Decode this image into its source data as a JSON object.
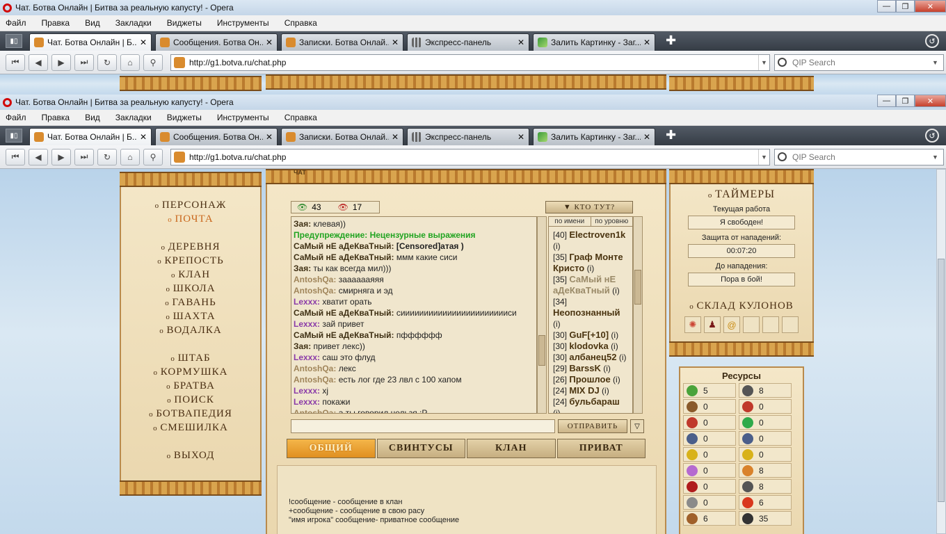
{
  "browser": {
    "title": "Чат. Ботва Онлайн | Битва за реальную капусту! - Opera",
    "menu": [
      "Файл",
      "Правка",
      "Вид",
      "Закладки",
      "Виджеты",
      "Инструменты",
      "Справка"
    ],
    "tabs": [
      {
        "label": "Чат. Ботва Онлайн | Б..."
      },
      {
        "label": "Сообщения. Ботва Он..."
      },
      {
        "label": "Записки. Ботва Онлай..."
      },
      {
        "label": "Экспресс-панель"
      },
      {
        "label": "Залить Картинку - Заг..."
      }
    ],
    "url": "http://g1.botva.ru/chat.php",
    "search_placeholder": "QIP Search"
  },
  "left_menu": [
    "ПЕРСОНАЖ",
    "ПОЧТА",
    "ДЕРЕВНЯ",
    "КРЕПОСТЬ",
    "КЛАН",
    "ШКОЛА",
    "ГАВАНЬ",
    "ШАХТА",
    "ВОДАЛКА",
    "ШТАБ",
    "КОРМУШКА",
    "БРАТВА",
    "ПОИСК",
    "БОТВАПЕДИЯ",
    "СМЕШИЛКА",
    "ВЫХОД"
  ],
  "chat": {
    "header_label": "ЧАТ",
    "online_count": "43",
    "watch_count": "17",
    "who_here": "КТО ТУТ?",
    "sort_by_name": "по имени",
    "sort_by_level": "по уровню",
    "send_label": "ОТПРАВИТЬ",
    "lines": [
      {
        "name": "Зая",
        "text": "клевая))",
        "cls": "n1"
      },
      {
        "name": "",
        "text": "Предупреждение: Нецензурные выражения",
        "cls": "warn"
      },
      {
        "name": "СаМый нЕ аДеКваТный",
        "text": "[Censored]атая )",
        "cls": "n1",
        "bold": true
      },
      {
        "name": "СаМый нЕ аДеКваТный",
        "text": "ммм какие сиси",
        "cls": "n1"
      },
      {
        "name": "Зая",
        "text": "ты как всегда мил)))",
        "cls": "n1"
      },
      {
        "name": "AntoshQa",
        "text": "зааааааяяя",
        "cls": "n2"
      },
      {
        "name": "AntoshQa",
        "text": "смирняга и эд",
        "cls": "n2"
      },
      {
        "name": "Lexxx",
        "text": "хватит орать",
        "cls": "n3"
      },
      {
        "name": "СаМый нЕ аДеКваТный",
        "text": "сиииииииииииииииииииииииси",
        "cls": "n1"
      },
      {
        "name": "Lexxx",
        "text": "зай привет",
        "cls": "n3"
      },
      {
        "name": "СаМый нЕ аДеКваТный",
        "text": "пфффффф",
        "cls": "n1"
      },
      {
        "name": "Зая",
        "text": "привет лекс))",
        "cls": "n1"
      },
      {
        "name": "Lexxx",
        "text": "саш это флуд",
        "cls": "n3"
      },
      {
        "name": "AntoshQa",
        "text": "лекс",
        "cls": "n2"
      },
      {
        "name": "AntoshQa",
        "text": "есть лог где 23 лвл с 100 хапом",
        "cls": "n2"
      },
      {
        "name": "Lexxx",
        "text": "xj",
        "cls": "n3"
      },
      {
        "name": "Lexxx",
        "text": "покажи",
        "cls": "n3"
      },
      {
        "name": "AntoshQa",
        "text": "а ты говорил нельзя :P",
        "cls": "n2"
      }
    ],
    "users": [
      {
        "level": "[40]",
        "name": "Electroven1k",
        "info": "(i)"
      },
      {
        "level": "[35]",
        "name": "Граф Монте Кристо",
        "info": "(i)"
      },
      {
        "level": "[35]",
        "name": "СаМый нЕ аДеКваТный",
        "info": "(i)",
        "gray": true
      },
      {
        "level": "[34]",
        "name": "Неопознанный",
        "info": "(i)"
      },
      {
        "level": "[30]",
        "name": "GuF[+10]",
        "info": "(i)"
      },
      {
        "level": "[30]",
        "name": "klodovka",
        "info": "(i)"
      },
      {
        "level": "[30]",
        "name": "албанец52",
        "info": "(i)"
      },
      {
        "level": "[29]",
        "name": "BarssK",
        "info": "(i)"
      },
      {
        "level": "[26]",
        "name": "Прошлое",
        "info": "(i)"
      },
      {
        "level": "[24]",
        "name": "MIX DJ",
        "info": "(i)"
      },
      {
        "level": "[24]",
        "name": "бульбараш",
        "info": "(i)"
      }
    ],
    "channels": [
      "ОБЩИЙ",
      "СВИНТУСЫ",
      "КЛАН",
      "ПРИВАТ"
    ],
    "help": [
      "!сообщение - сообщение в клан",
      "+сообщение - сообщение в свою расу",
      "\"имя игрока\" сообщение- приватное сообщение"
    ]
  },
  "timers": {
    "title": "ТАЙМЕРЫ",
    "current_work_label": "Текущая работа",
    "current_work_value": "Я свободен!",
    "protection_label": "Защита от нападений:",
    "protection_value": "00:07:20",
    "attack_label": "До нападения:",
    "attack_value": "Пора в бой!"
  },
  "amulets_title": "СКЛАД КУЛОНОВ",
  "resources": {
    "title": "Ресурсы",
    "items": [
      {
        "value": "5",
        "color": "#4aa33a"
      },
      {
        "value": "8",
        "color": "#555555"
      },
      {
        "value": "0",
        "color": "#8a5a2a"
      },
      {
        "value": "0",
        "color": "#c0392b"
      },
      {
        "value": "0",
        "color": "#c0392b"
      },
      {
        "value": "0",
        "color": "#2eaa4a"
      },
      {
        "value": "0",
        "color": "#4b5f8a"
      },
      {
        "value": "0",
        "color": "#4b5f8a"
      },
      {
        "value": "0",
        "color": "#d8b21a"
      },
      {
        "value": "0",
        "color": "#d8b21a"
      },
      {
        "value": "0",
        "color": "#b56ad0"
      },
      {
        "value": "8",
        "color": "#d9822b"
      },
      {
        "value": "0",
        "color": "#b01c1c"
      },
      {
        "value": "8",
        "color": "#555555"
      },
      {
        "value": "0",
        "color": "#8a8a8a"
      },
      {
        "value": "6",
        "color": "#d9381e"
      },
      {
        "value": "6",
        "color": "#a0602a"
      },
      {
        "value": "35",
        "color": "#333333"
      }
    ]
  }
}
